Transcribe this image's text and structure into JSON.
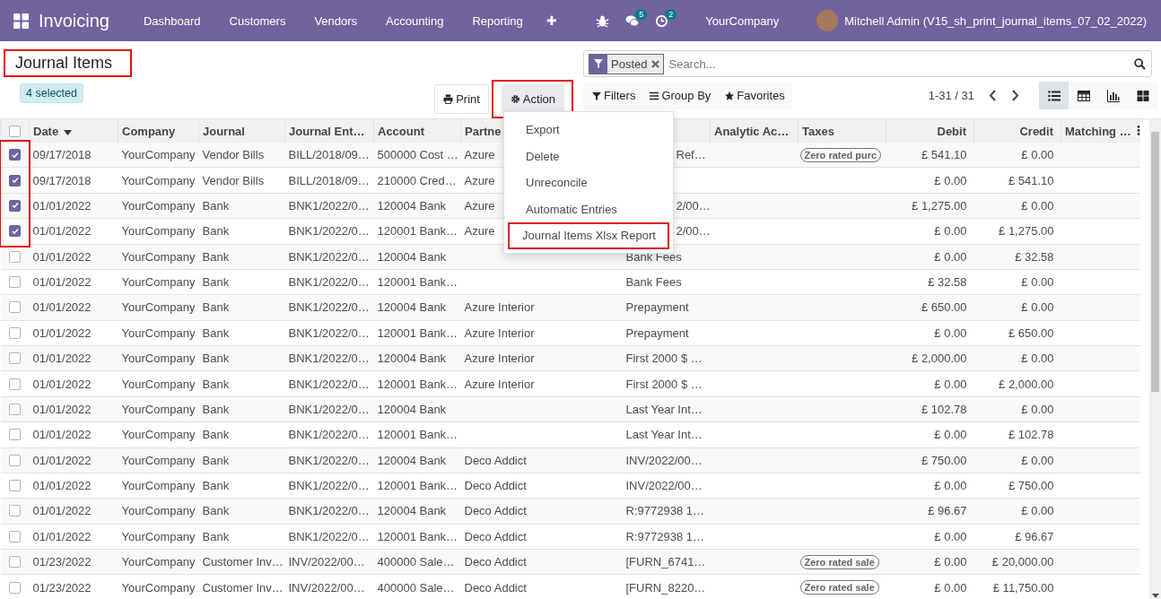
{
  "navbar": {
    "app_title": "Invoicing",
    "menu": [
      "Dashboard",
      "Customers",
      "Vendors",
      "Accounting",
      "Reporting"
    ],
    "plus": "✚",
    "messages_count": "5",
    "activities_count": "2",
    "company": "YourCompany",
    "user": "Mitchell Admin (V15_sh_print_journal_items_07_02_2022)"
  },
  "control_panel": {
    "title": "Journal Items",
    "title_highlighted": true,
    "selection": "4 selected",
    "print_button": "Print",
    "action_button": "Action",
    "action_highlighted": true,
    "action_menu": [
      {
        "label": "Export",
        "highlighted": false
      },
      {
        "label": "Delete",
        "highlighted": false
      },
      {
        "label": "Unreconcile",
        "highlighted": false
      },
      {
        "label": "Automatic Entries",
        "highlighted": false
      },
      {
        "label": "Journal Items Xlsx Report",
        "highlighted": true
      }
    ],
    "search": {
      "facet": "Posted",
      "placeholder": "Search..."
    },
    "filters": [
      "Filters",
      "Group By",
      "Favorites"
    ],
    "pager": "1-31 / 31",
    "views": [
      {
        "kind": "list",
        "selected": true
      },
      {
        "kind": "pivot",
        "selected": false
      },
      {
        "kind": "graph",
        "selected": false
      },
      {
        "kind": "kanban",
        "selected": false
      }
    ]
  },
  "table": {
    "select_all_checked": false,
    "checkbox_highlighted": true,
    "columns": [
      "Date",
      "Company",
      "Journal",
      "Journal Ent…",
      "Account",
      "Partne",
      "",
      "Analytic Ac…",
      "Taxes",
      "Debit",
      "Credit",
      "Matching …"
    ],
    "rows": [
      {
        "checked": true,
        "cells": [
          "09/17/2018",
          "YourCompany",
          "Vendor Bills",
          "BILL/2018/09…",
          "500000 Cost …",
          "Azure",
          "Ref…",
          "",
          "Zero rated purc",
          "£ 541.10",
          "£ 0.00",
          ""
        ]
      },
      {
        "checked": true,
        "cells": [
          "09/17/2018",
          "YourCompany",
          "Vendor Bills",
          "BILL/2018/09…",
          "210000 Cred…",
          "Azure",
          "",
          "",
          "",
          "£ 0.00",
          "£ 541.10",
          ""
        ]
      },
      {
        "checked": true,
        "cells": [
          "01/01/2022",
          "YourCompany",
          "Bank",
          "BNK1/2022/0…",
          "120004 Bank",
          "Azure",
          "2/00…",
          "",
          "",
          "£ 1,275.00",
          "£ 0.00",
          ""
        ]
      },
      {
        "checked": true,
        "cells": [
          "01/01/2022",
          "YourCompany",
          "Bank",
          "BNK1/2022/0…",
          "120001 Bank…",
          "Azure",
          "2/00…",
          "",
          "",
          "£ 0.00",
          "£ 1,275.00",
          ""
        ]
      },
      {
        "checked": false,
        "cells": [
          "01/01/2022",
          "YourCompany",
          "Bank",
          "BNK1/2022/0…",
          "120004 Bank",
          "",
          "Bank Fees",
          "",
          "",
          "£ 0.00",
          "£ 32.58",
          ""
        ]
      },
      {
        "checked": false,
        "cells": [
          "01/01/2022",
          "YourCompany",
          "Bank",
          "BNK1/2022/0…",
          "120001 Bank…",
          "",
          "Bank Fees",
          "",
          "",
          "£ 32.58",
          "£ 0.00",
          ""
        ]
      },
      {
        "checked": false,
        "cells": [
          "01/01/2022",
          "YourCompany",
          "Bank",
          "BNK1/2022/0…",
          "120004 Bank",
          "Azure Interior",
          "Prepayment",
          "",
          "",
          "£ 650.00",
          "£ 0.00",
          ""
        ]
      },
      {
        "checked": false,
        "cells": [
          "01/01/2022",
          "YourCompany",
          "Bank",
          "BNK1/2022/0…",
          "120001 Bank…",
          "Azure Interior",
          "Prepayment",
          "",
          "",
          "£ 0.00",
          "£ 650.00",
          ""
        ]
      },
      {
        "checked": false,
        "cells": [
          "01/01/2022",
          "YourCompany",
          "Bank",
          "BNK1/2022/0…",
          "120004 Bank",
          "Azure Interior",
          "First 2000 $ …",
          "",
          "",
          "£ 2,000.00",
          "£ 0.00",
          ""
        ]
      },
      {
        "checked": false,
        "cells": [
          "01/01/2022",
          "YourCompany",
          "Bank",
          "BNK1/2022/0…",
          "120001 Bank…",
          "Azure Interior",
          "First 2000 $ …",
          "",
          "",
          "£ 0.00",
          "£ 2,000.00",
          ""
        ]
      },
      {
        "checked": false,
        "cells": [
          "01/01/2022",
          "YourCompany",
          "Bank",
          "BNK1/2022/0…",
          "120004 Bank",
          "",
          "Last Year Int…",
          "",
          "",
          "£ 102.78",
          "£ 0.00",
          ""
        ]
      },
      {
        "checked": false,
        "cells": [
          "01/01/2022",
          "YourCompany",
          "Bank",
          "BNK1/2022/0…",
          "120001 Bank…",
          "",
          "Last Year Int…",
          "",
          "",
          "£ 0.00",
          "£ 102.78",
          ""
        ]
      },
      {
        "checked": false,
        "cells": [
          "01/01/2022",
          "YourCompany",
          "Bank",
          "BNK1/2022/0…",
          "120004 Bank",
          "Deco Addict",
          "INV/2022/00…",
          "",
          "",
          "£ 750.00",
          "£ 0.00",
          ""
        ]
      },
      {
        "checked": false,
        "cells": [
          "01/01/2022",
          "YourCompany",
          "Bank",
          "BNK1/2022/0…",
          "120001 Bank…",
          "Deco Addict",
          "INV/2022/00…",
          "",
          "",
          "£ 0.00",
          "£ 750.00",
          ""
        ]
      },
      {
        "checked": false,
        "cells": [
          "01/01/2022",
          "YourCompany",
          "Bank",
          "BNK1/2022/0…",
          "120004 Bank",
          "Deco Addict",
          "R:9772938 1…",
          "",
          "",
          "£ 96.67",
          "£ 0.00",
          ""
        ]
      },
      {
        "checked": false,
        "cells": [
          "01/01/2022",
          "YourCompany",
          "Bank",
          "BNK1/2022/0…",
          "120001 Bank…",
          "Deco Addict",
          "R:9772938 1…",
          "",
          "",
          "£ 0.00",
          "£ 96.67",
          ""
        ]
      },
      {
        "checked": false,
        "cells": [
          "01/23/2022",
          "YourCompany",
          "Customer Inv…",
          "INV/2022/00…",
          "400000 Sale…",
          "Deco Addict",
          "[FURN_6741…",
          "",
          "Zero rated sale",
          "£ 0.00",
          "£ 20,000.00",
          ""
        ]
      },
      {
        "checked": false,
        "cells": [
          "01/23/2022",
          "YourCompany",
          "Customer Inv…",
          "INV/2022/00…",
          "400000 Sale…",
          "Deco Addict",
          "[FURN_8220…",
          "",
          "Zero rated sale",
          "£ 0.00",
          "£ 11,750.00",
          ""
        ]
      }
    ]
  }
}
